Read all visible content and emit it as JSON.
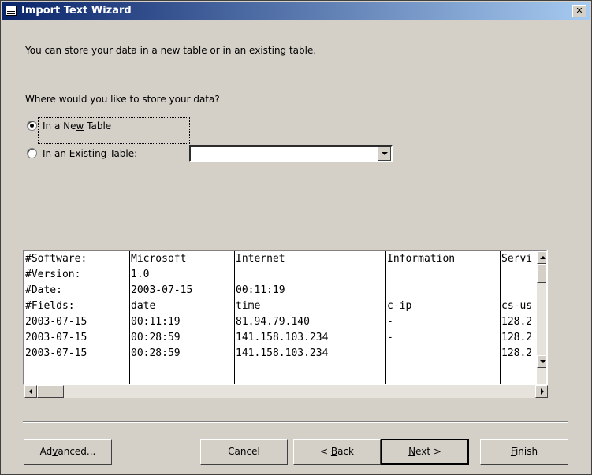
{
  "window": {
    "title": "Import Text Wizard",
    "close_symbol": "✕"
  },
  "intro_text": "You can store your data in a new table or in an existing table.",
  "question_text": "Where would you like to store your data?",
  "options": {
    "new_table": {
      "pre": "In a Ne",
      "key": "w",
      "post": " Table",
      "selected": true
    },
    "existing_table": {
      "pre": "In an E",
      "key": "x",
      "post": "isting Table:",
      "selected": false
    }
  },
  "existing_table_combo": {
    "value": ""
  },
  "preview_rows": [
    [
      "#Software:",
      "Microsoft",
      "Internet",
      "Information",
      "Servi"
    ],
    [
      "#Version:",
      "1.0",
      "",
      "",
      ""
    ],
    [
      "#Date:",
      "2003-07-15",
      "00:11:19",
      "",
      ""
    ],
    [
      "#Fields:",
      "date",
      "time",
      "c-ip",
      "cs-us"
    ],
    [
      "2003-07-15",
      "00:11:19",
      "81.94.79.140",
      "-",
      "128.2"
    ],
    [
      "2003-07-15",
      "00:28:59",
      "141.158.103.234",
      "-",
      "128.2"
    ],
    [
      "2003-07-15",
      "00:28:59",
      "141.158.103.234",
      "",
      "128.2"
    ]
  ],
  "buttons": {
    "advanced": {
      "pre": "Ad",
      "key": "v",
      "post": "anced..."
    },
    "cancel": {
      "pre": "Cancel",
      "key": "",
      "post": ""
    },
    "back": {
      "pre": "< ",
      "key": "B",
      "post": "ack"
    },
    "next": {
      "pre": "",
      "key": "N",
      "post": "ext >"
    },
    "finish": {
      "pre": "",
      "key": "F",
      "post": "inish"
    }
  }
}
